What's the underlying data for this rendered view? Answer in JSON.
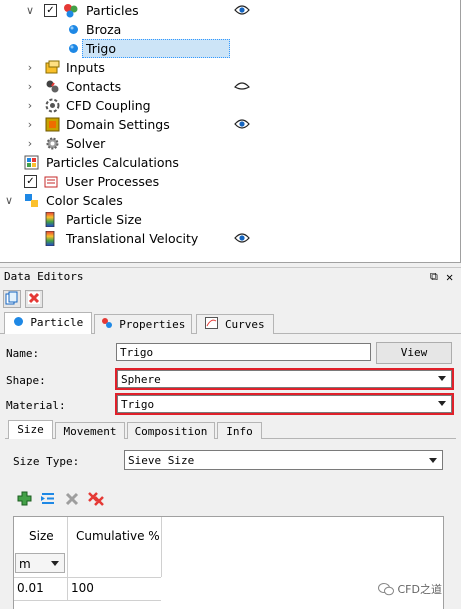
{
  "tree": {
    "particles": {
      "label": "Particles"
    },
    "broza": {
      "label": "Broza"
    },
    "trigo": {
      "label": "Trigo"
    },
    "inputs": {
      "label": "Inputs"
    },
    "contacts": {
      "label": "Contacts"
    },
    "cfd_coupling": {
      "label": "CFD Coupling"
    },
    "domain_settings": {
      "label": "Domain Settings"
    },
    "solver": {
      "label": "Solver"
    },
    "particles_calculations": {
      "label": "Particles Calculations"
    },
    "user_processes": {
      "label": "User Processes"
    },
    "color_scales": {
      "label": "Color Scales"
    },
    "particle_size": {
      "label": "Particle Size"
    },
    "translational_velocity": {
      "label": "Translational Velocity"
    }
  },
  "data_editors": {
    "title": "Data Editors",
    "tabs": [
      "Particle",
      "Properties",
      "Curves"
    ],
    "name_label": "Name:",
    "name_value": "Trigo",
    "view_button": "View",
    "shape_label": "Shape:",
    "shape_value": "Sphere",
    "material_label": "Material:",
    "material_value": "Trigo",
    "subtabs": [
      "Size",
      "Movement",
      "Composition",
      "Info"
    ],
    "size_type_label": "Size Type:",
    "size_type_value": "Sieve Size",
    "table": {
      "col_size": "Size",
      "col_cumulative": "Cumulative %",
      "unit": "m",
      "rows": [
        {
          "size": "0.01",
          "cumulative": "100"
        }
      ]
    }
  },
  "watermark": "CFD之道",
  "colors": {
    "selection": "#cce4f7",
    "highlight_border": "#e0202a",
    "particle_dot": "#1e88e5"
  }
}
